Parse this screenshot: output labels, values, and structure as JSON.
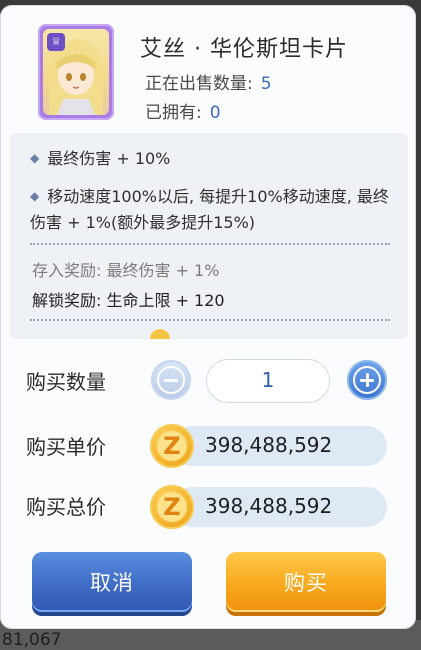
{
  "card": {
    "title": "艾丝 · 华伦斯坦卡片",
    "on_sale_label": "正在出售数量:",
    "on_sale_value": "5",
    "owned_label": "已拥有:",
    "owned_value": "0"
  },
  "effects": {
    "line1": "最终伤害 + 10%",
    "line2": "移动速度100%以后, 每提升10%移动速度, 最终伤害 + 1%(额外最多提升15%)",
    "store_reward": "存入奖励: 最终伤害 + 1%",
    "unlock_reward": "解锁奖励: 生命上限 + 120"
  },
  "purchase": {
    "quantity_label": "购买数量",
    "quantity_value": "1",
    "unit_price_label": "购买单价",
    "unit_price_value": "398,488,592",
    "total_price_label": "购买总价",
    "total_price_value": "398,488,592"
  },
  "buttons": {
    "cancel": "取消",
    "buy": "购买"
  },
  "background": {
    "partial_number": "81,067"
  }
}
